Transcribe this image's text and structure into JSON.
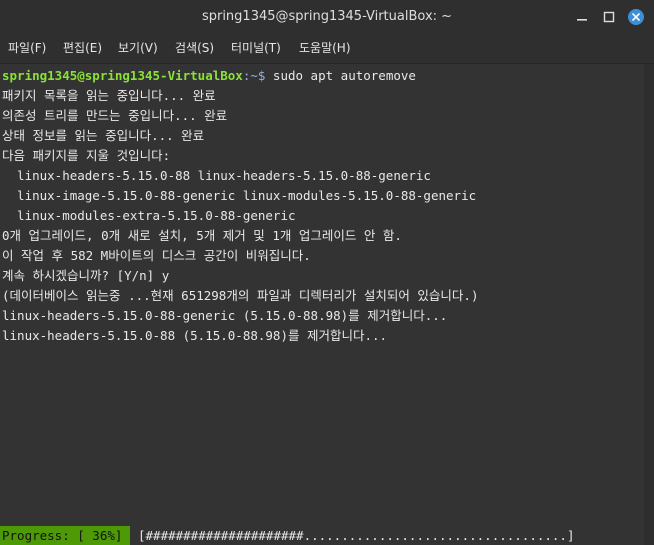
{
  "window": {
    "title": "spring1345@spring1345-VirtualBox: ~"
  },
  "menu": {
    "items": [
      "파일(F)",
      "편집(E)",
      "보기(V)",
      "검색(S)",
      "터미널(T)",
      "도움말(H)"
    ]
  },
  "terminal": {
    "prompt_user": "spring1345@spring1345-VirtualBox",
    "prompt_path": ":~$",
    "command": " sudo apt autoremove",
    "output": [
      "패키지 목록을 읽는 중입니다... 완료",
      "의존성 트리를 만드는 중입니다... 완료",
      "상태 정보를 읽는 중입니다... 완료",
      "다음 패키지를 지울 것입니다:",
      "  linux-headers-5.15.0-88 linux-headers-5.15.0-88-generic",
      "  linux-image-5.15.0-88-generic linux-modules-5.15.0-88-generic",
      "  linux-modules-extra-5.15.0-88-generic",
      "0개 업그레이드, 0개 새로 설치, 5개 제거 및 1개 업그레이드 안 함.",
      "이 작업 후 582 M바이트의 디스크 공간이 비워집니다.",
      "계속 하시겠습니까? [Y/n] y",
      "(데이터베이스 읽는중 ...현재 651298개의 파일과 디렉터리가 설치되어 있습니다.)",
      "linux-headers-5.15.0-88-generic (5.15.0-88.98)를 제거합니다...",
      "linux-headers-5.15.0-88 (5.15.0-88.98)를 제거합니다..."
    ]
  },
  "progress": {
    "label": "Progress: [ 36%]",
    "percent": 36,
    "bar": "[#####################...................................]"
  },
  "colors": {
    "prompt_user": "#8ae234",
    "prompt_path": "#9ab0d8",
    "progress_bg": "#4e9a06",
    "close_button": "#3c8fd6"
  }
}
